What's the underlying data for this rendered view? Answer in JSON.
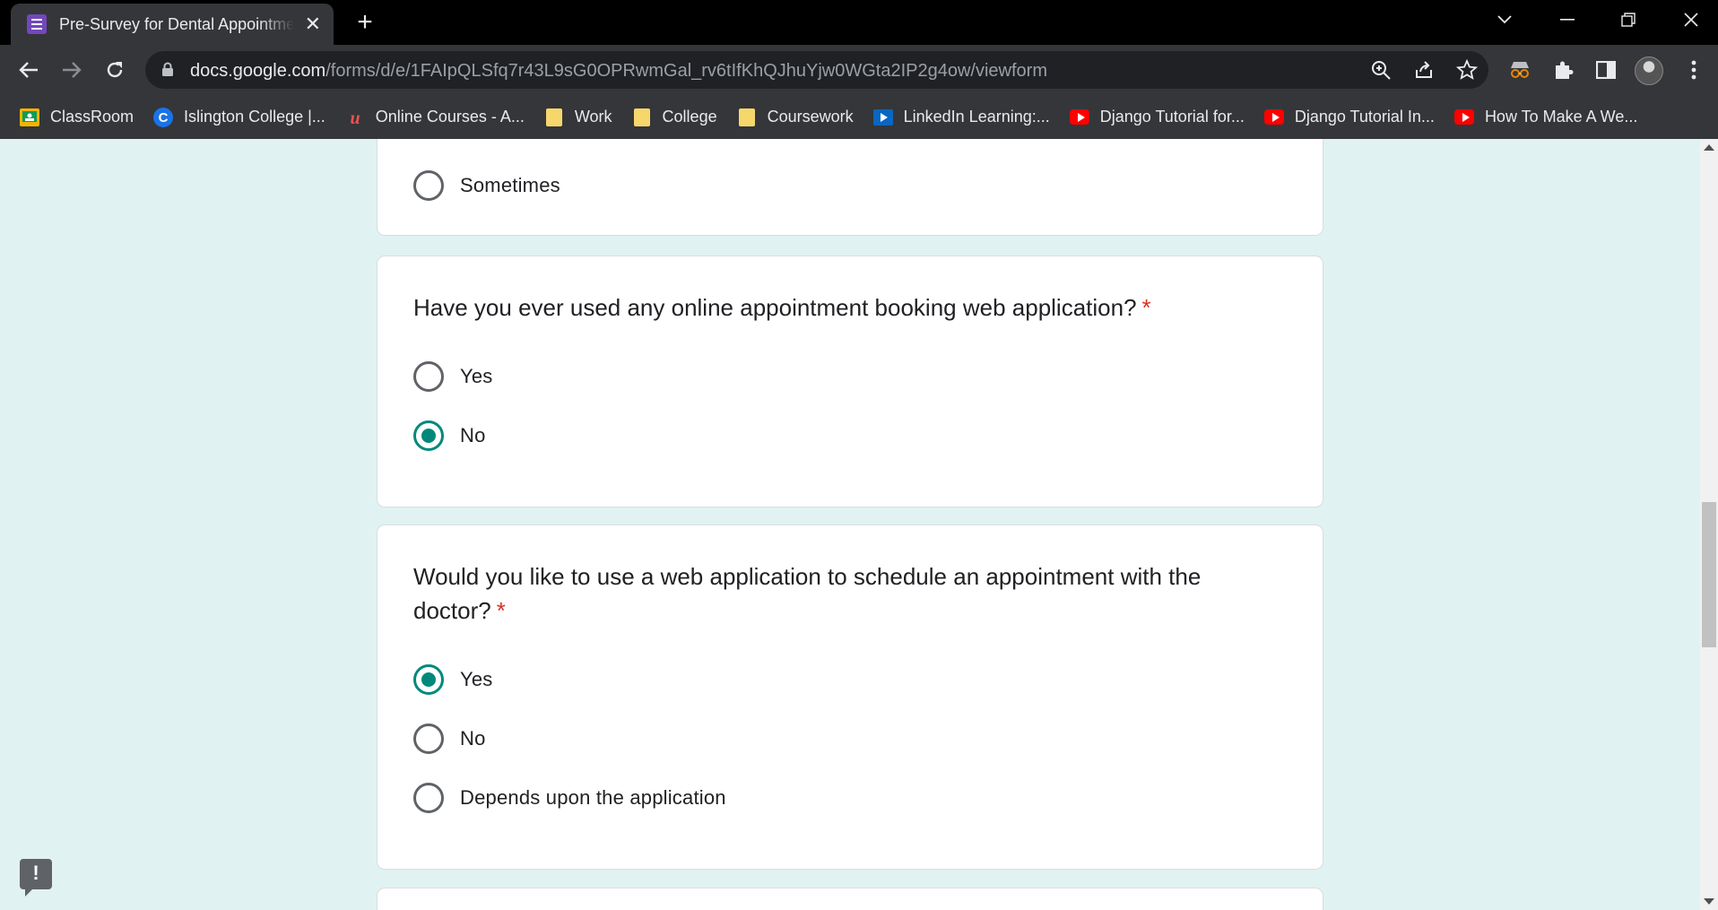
{
  "browser": {
    "tab_title": "Pre-Survey for Dental Appointment",
    "url_host": "docs.google.com",
    "url_path": "/forms/d/e/1FAIpQLSfq7r43L9sG0OPRwmGal_rv6tIfKhQJhuYjw0WGta2IP2g4ow/viewform",
    "bookmarks": [
      {
        "label": "ClassRoom",
        "icon": "classroom-icon"
      },
      {
        "label": "Islington College |...",
        "icon": "college-c-icon"
      },
      {
        "label": "Online Courses - A...",
        "icon": "udemy-icon"
      },
      {
        "label": "Work",
        "icon": "folder-icon"
      },
      {
        "label": "College",
        "icon": "folder-icon"
      },
      {
        "label": "Coursework",
        "icon": "folder-icon"
      },
      {
        "label": "LinkedIn Learning:...",
        "icon": "linkedin-learning-icon"
      },
      {
        "label": "Django Tutorial for...",
        "icon": "youtube-icon"
      },
      {
        "label": "Django Tutorial In...",
        "icon": "youtube-icon"
      },
      {
        "label": "How To Make A We...",
        "icon": "youtube-icon"
      }
    ]
  },
  "form": {
    "prev_card": {
      "options": [
        {
          "label": "Sometimes",
          "checked": false
        }
      ]
    },
    "q1": {
      "question": "Have you ever used any online appointment booking web application?",
      "required_mark": "*",
      "options": [
        {
          "label": "Yes",
          "checked": false
        },
        {
          "label": "No",
          "checked": true
        }
      ]
    },
    "q2": {
      "question": "Would you like to use a web application to schedule an appointment with the doctor?",
      "required_mark": "*",
      "options": [
        {
          "label": "Yes",
          "checked": true
        },
        {
          "label": "No",
          "checked": false
        },
        {
          "label": "Depends upon the application",
          "checked": false
        }
      ]
    },
    "feedback_glyph": "!"
  },
  "colors": {
    "accent": "#00897b",
    "page_bg": "#e0f2f1",
    "required": "#d93025"
  }
}
